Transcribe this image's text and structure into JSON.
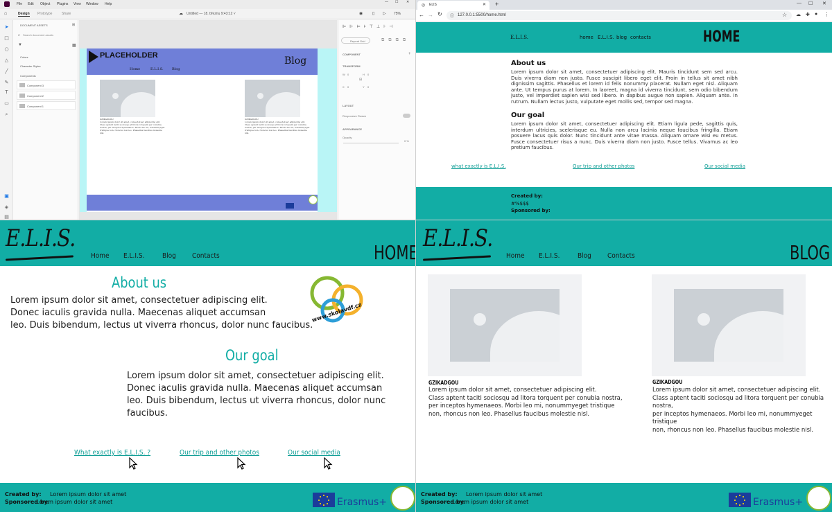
{
  "design_tool": {
    "menu": [
      "File",
      "Edit",
      "Object",
      "Plugins",
      "View",
      "Window",
      "Help"
    ],
    "tabs": [
      "Design",
      "Prototype",
      "Share"
    ],
    "doc_title": "Untitled — 18. březnu 9:43:12 ˅",
    "zoom": "75%",
    "assets_header": "DOCUMENT ASSETS",
    "assets_search": "Search document assets",
    "asset_sections": [
      "Colors",
      "Character Styles",
      "Components"
    ],
    "components": [
      "Component 3",
      "Component 2",
      "Component 1"
    ],
    "mock": {
      "logo": "PLACEHOLDER",
      "title": "Blog",
      "nav": [
        "Home",
        "E.L.I.S.",
        "Blog"
      ],
      "card_title": "GZIKADGOU",
      "card_text": "Lorem ipsum dolor sit amet, consectetuer adipiscing elit. Class aptent taciti sociosqu ad litora torquent per conubia nostra, per inceptos hymenaeos. Morbi leo mi, nonummyeget tristique non, rhoncus non leo. Phasellus faucibus molestie nisl."
    },
    "props": {
      "repeat_grid": "Repeat Grid",
      "component": "COMPONENT",
      "transform": "TRANSFORM",
      "w_label": "W",
      "w_val": "0",
      "h_label": "H",
      "h_val": "0",
      "x_label": "X",
      "x_val": "0",
      "y_label": "Y",
      "y_val": "0",
      "layout": "LAYOUT",
      "responsive": "Responsive Resize",
      "appearance": "APPEARANCE",
      "opacity": "Opacity",
      "opacity_val": "0 %"
    }
  },
  "browser": {
    "tab_title": "ELIS",
    "url": "127.0.0.1:5500/home.html",
    "site": {
      "brand": "E.L.I.S.",
      "nav": [
        "home",
        "E.L.I.S.",
        "blog",
        "contacts"
      ],
      "title": "HOME",
      "about_title": "About us",
      "about_text": "Lorem ipsum dolor sit amet, consectetuer adipiscing elit. Mauris tincidunt sem sed arcu. Duis viverra diam non justo. Fusce suscipit libero eget elit. Proin in tellus sit amet nibh dignissim sagittis. Phasellus et lorem id felis nonummy placerat. Nullam eget nisl. Aliquam ante. Ut tempus purus at lorem. In laoreet, magna id viverra tincidunt, sem odio bibendum justo, vel imperdiet sapien wisi sed libero. In dapibus augue non sapien. Aliquam ante. In rutrum. Nullam lectus justo, vulputate eget mollis sed, tempor sed magna.",
      "goal_title": "Our goal",
      "goal_text": "Lorem ipsum dolor sit amet, consectetuer adipiscing elit. Etiam ligula pede, sagittis quis, interdum ultricies, scelerisque eu. Nulla non arcu lacinia neque faucibus fringilla. Etiam posuere lacus quis dolor. Nunc tincidunt ante vitae massa. Aliquam ornare wisi eu metus. Fusce consectetuer risus a nunc. Duis viverra diam non justo. Fusce tellus. Vivamus ac leo pretium faucibus.",
      "links": [
        "what exactly is E.L.I.S.",
        "Our trip and other photos",
        "Our social media"
      ],
      "created_by": "Created by:",
      "created_name": "#%$$$",
      "sponsored_by": "Sponsored by:"
    }
  },
  "home_page": {
    "logo": "E.L.I.S.",
    "nav": [
      "Home",
      "E.L.I.S.",
      "Blog",
      "Contacts"
    ],
    "title": "HOME",
    "about_title": "About us",
    "about_lines": [
      "Lorem ipsum dolor sit amet, consectetuer adipiscing elit.",
      "Donec iaculis gravida nulla. Maecenas aliquet accumsan",
      "leo. Duis bibendum, lectus ut viverra rhoncus, dolor nunc faucibus."
    ],
    "school_url": "www.skolavdf.cz",
    "goal_title": "Our goal",
    "goal_lines": [
      "Lorem ipsum dolor sit amet, consectetuer adipiscing elit.",
      "Donec iaculis gravida nulla. Maecenas aliquet accumsan",
      "leo. Duis bibendum, lectus ut viverra rhoncus, dolor nunc faucibus."
    ],
    "links": [
      "What exactly is E.L.I.S. ?",
      "Our trip and other photos",
      "Our social media"
    ],
    "created_label": "Created by:",
    "created_text": "Lorem ipsum dolor sit amet",
    "sponsored_label": "Sponsored by:",
    "sponsored_text": "Lorem ipsum dolor sit amet",
    "erasmus": "Erasmus+"
  },
  "blog_page": {
    "logo": "E.L.I.S.",
    "nav": [
      "Home",
      "E.L.I.S.",
      "Blog",
      "Contacts"
    ],
    "title": "BLOG",
    "cards": [
      {
        "title": "GZIKADGOU",
        "lines": [
          "Lorem ipsum dolor sit amet, consectetuer adipiscing elit.",
          "Class aptent taciti sociosqu ad litora torquent per conubia nostra,",
          "per inceptos hymenaeos. Morbi leo mi, nonummyeget tristique",
          "non, rhoncus non leo. Phasellus faucibus molestie nisl."
        ]
      },
      {
        "title": "GZIKADGOU",
        "lines": [
          "Lorem ipsum dolor sit amet, consectetuer adipiscing elit.",
          "Class aptent taciti sociosqu ad litora torquent per conubia nostra,",
          "per inceptos hymenaeos. Morbi leo mi, nonummyeget tristique",
          "non, rhoncus non leo. Phasellus faucibus molestie nisl."
        ]
      }
    ],
    "created_label": "Created by:",
    "created_text": "Lorem ipsum dolor sit amet",
    "sponsored_label": "Sponsored by:",
    "sponsored_text": "Lorem ipsum dolor sit amet",
    "erasmus": "Erasmus+"
  },
  "colors": {
    "teal": "#12ada5",
    "link_teal": "#0f9e96",
    "mock_header": "#6f7fd8",
    "artboard_bg": "#b9f5f6",
    "eu_blue": "#1b3c9b"
  }
}
